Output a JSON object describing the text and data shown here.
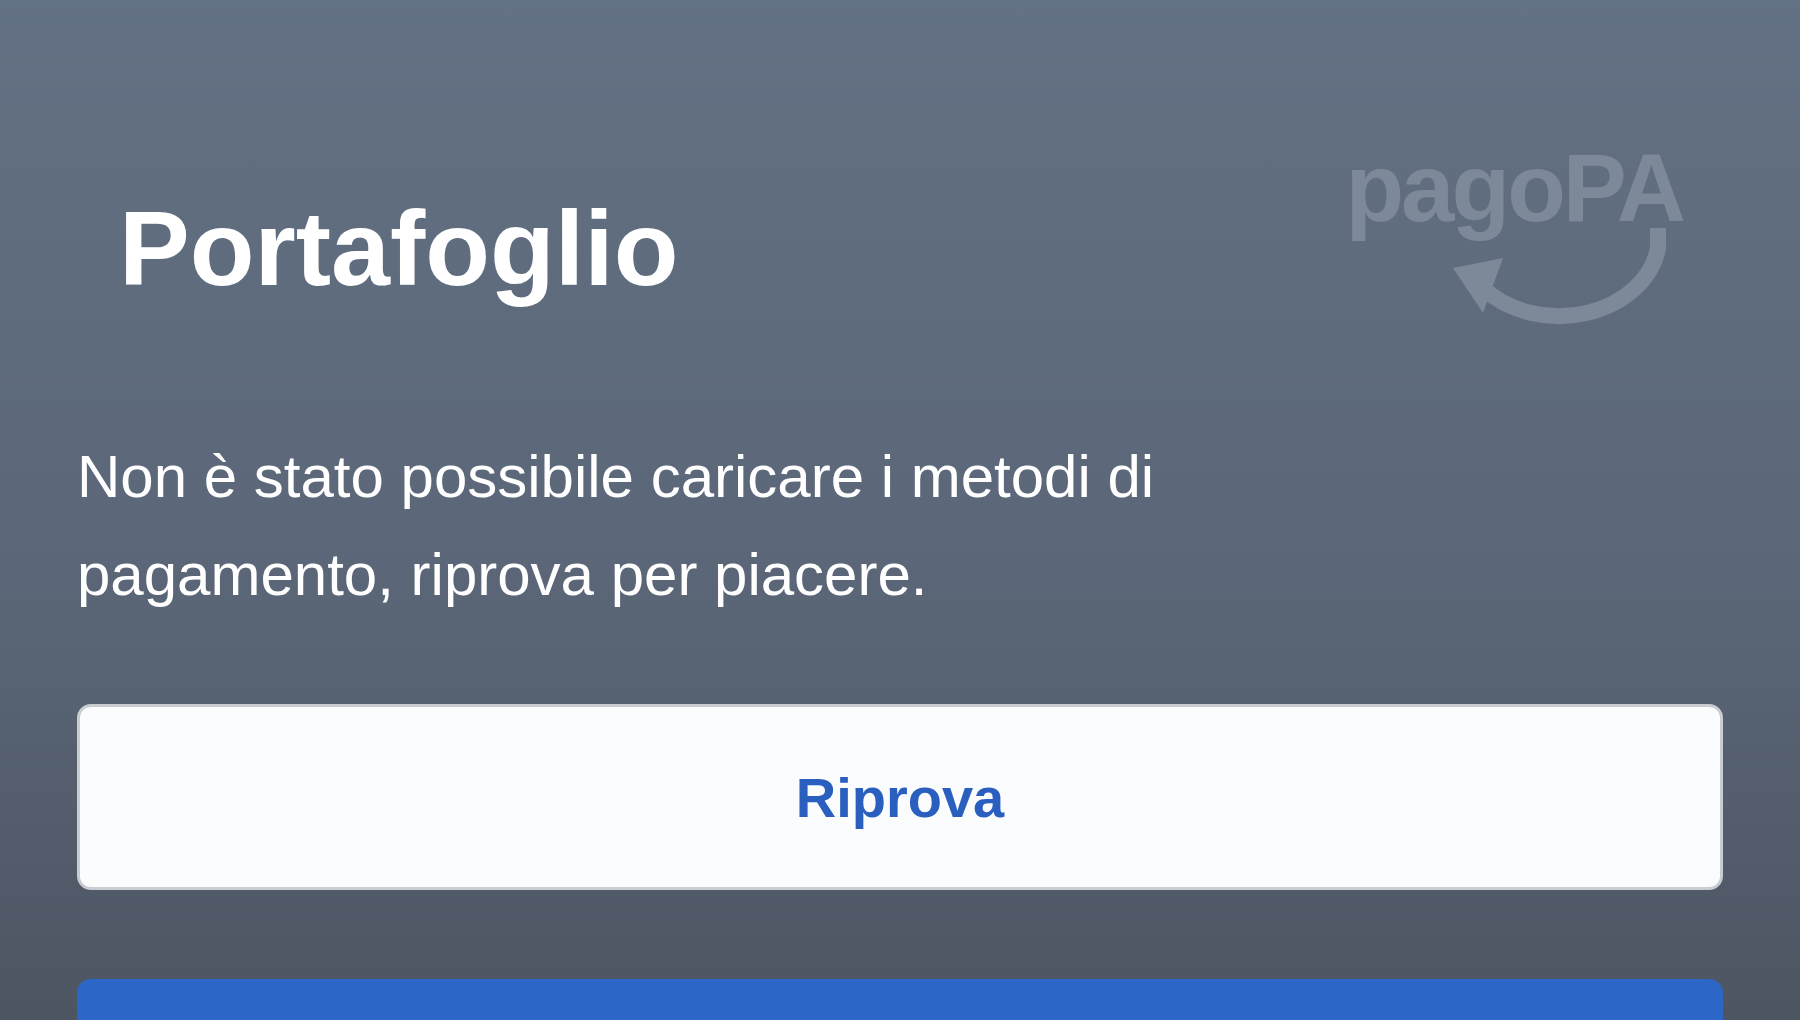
{
  "header": {
    "title": "Portafoglio",
    "logo": "pagoPA"
  },
  "message": "Non è stato possibile caricare i metodi di pagamento, riprova per piacere.",
  "buttons": [
    {
      "label": "Riprova",
      "kind": "secondary"
    },
    {
      "kind": "primary"
    }
  ]
}
